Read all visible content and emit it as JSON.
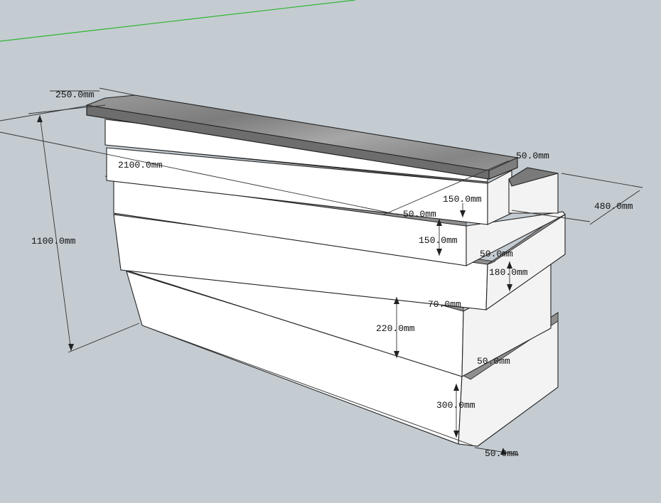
{
  "scene": {
    "axis_color": "#2fb52f",
    "background": "#c4ccd2",
    "countertop_color": "#8a8a8a"
  },
  "dimensions": {
    "top_depth": "250.0mm",
    "top_thickness": "50.0mm",
    "total_length": "2100.0mm",
    "total_height": "1100.0mm",
    "tier1_height": "150.0mm",
    "gap1": "50.0mm",
    "tier2_height": "150.0mm",
    "total_depth": "480.0mm",
    "gap2": "50.0mm",
    "tier3_height": "180.0mm",
    "gap3": "70.0mm",
    "tier4_height": "220.0mm",
    "gap4": "50.0mm",
    "tier5_height": "300.0mm",
    "plinth": "50.0mm"
  }
}
